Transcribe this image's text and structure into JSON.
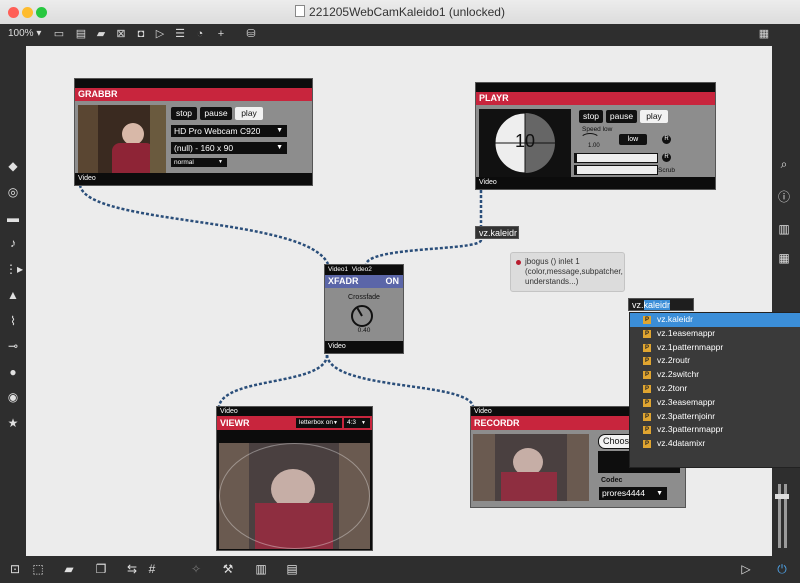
{
  "window": {
    "title": "221205WebCamKaleido1 (unlocked)"
  },
  "toolbar": {
    "zoom": "100% ▾",
    "add_icon": "+",
    "paint_icon": "paint-bucket"
  },
  "grabbr": {
    "title": "GRABBR",
    "stop": "stop",
    "pause": "pause",
    "play": "play",
    "device": "HD Pro Webcam C920",
    "format": "(null) - 160 x 90",
    "mode": "normal",
    "out": "Video"
  },
  "playr": {
    "title": "PLAYR",
    "stop": "stop",
    "pause": "pause",
    "play": "play",
    "speed_label": "Speed low",
    "speed_value": "1.00",
    "low_btn": "low",
    "r1": "R",
    "r2": "R",
    "r3": "R",
    "scrub": "Scrub",
    "countdown": "10",
    "out": "Video"
  },
  "kaleidr_obj": "vz.kaleidr",
  "comment": {
    "text1": "jbogus () inlet 1",
    "text2": "(color,message,subpatcher,",
    "text3": "understands...)"
  },
  "xfadr": {
    "in1": "Video1",
    "in2": "Video2",
    "title": "XFADR",
    "state": "ON",
    "label": "Crossfade",
    "value": "0.40",
    "out": "Video"
  },
  "viewr": {
    "in": "Video",
    "title": "VIEWR",
    "letterbox": "letterbox on",
    "aspect": "4:3"
  },
  "recordr": {
    "in": "Video",
    "title": "RECORDR",
    "choose": "Choose",
    "rec": "R",
    "codec_label": "Codec",
    "codec": "prores4444"
  },
  "typing": {
    "prefix": "vz.",
    "selected": "kaleidr"
  },
  "autocomplete": [
    "vz.kaleidr",
    "vz.1easemappr",
    "vz.1patternmappr",
    "vz.2routr",
    "vz.2switchr",
    "vz.2tonr",
    "vz.3easemappr",
    "vz.3patternjoinr",
    "vz.3patternmappr",
    "vz.4datamixr"
  ],
  "colors": {
    "header_red": "#c8253d",
    "xfadr_blue": "#5b66a8",
    "selection_blue": "#3b8ed8",
    "canvas": "#ececec"
  }
}
